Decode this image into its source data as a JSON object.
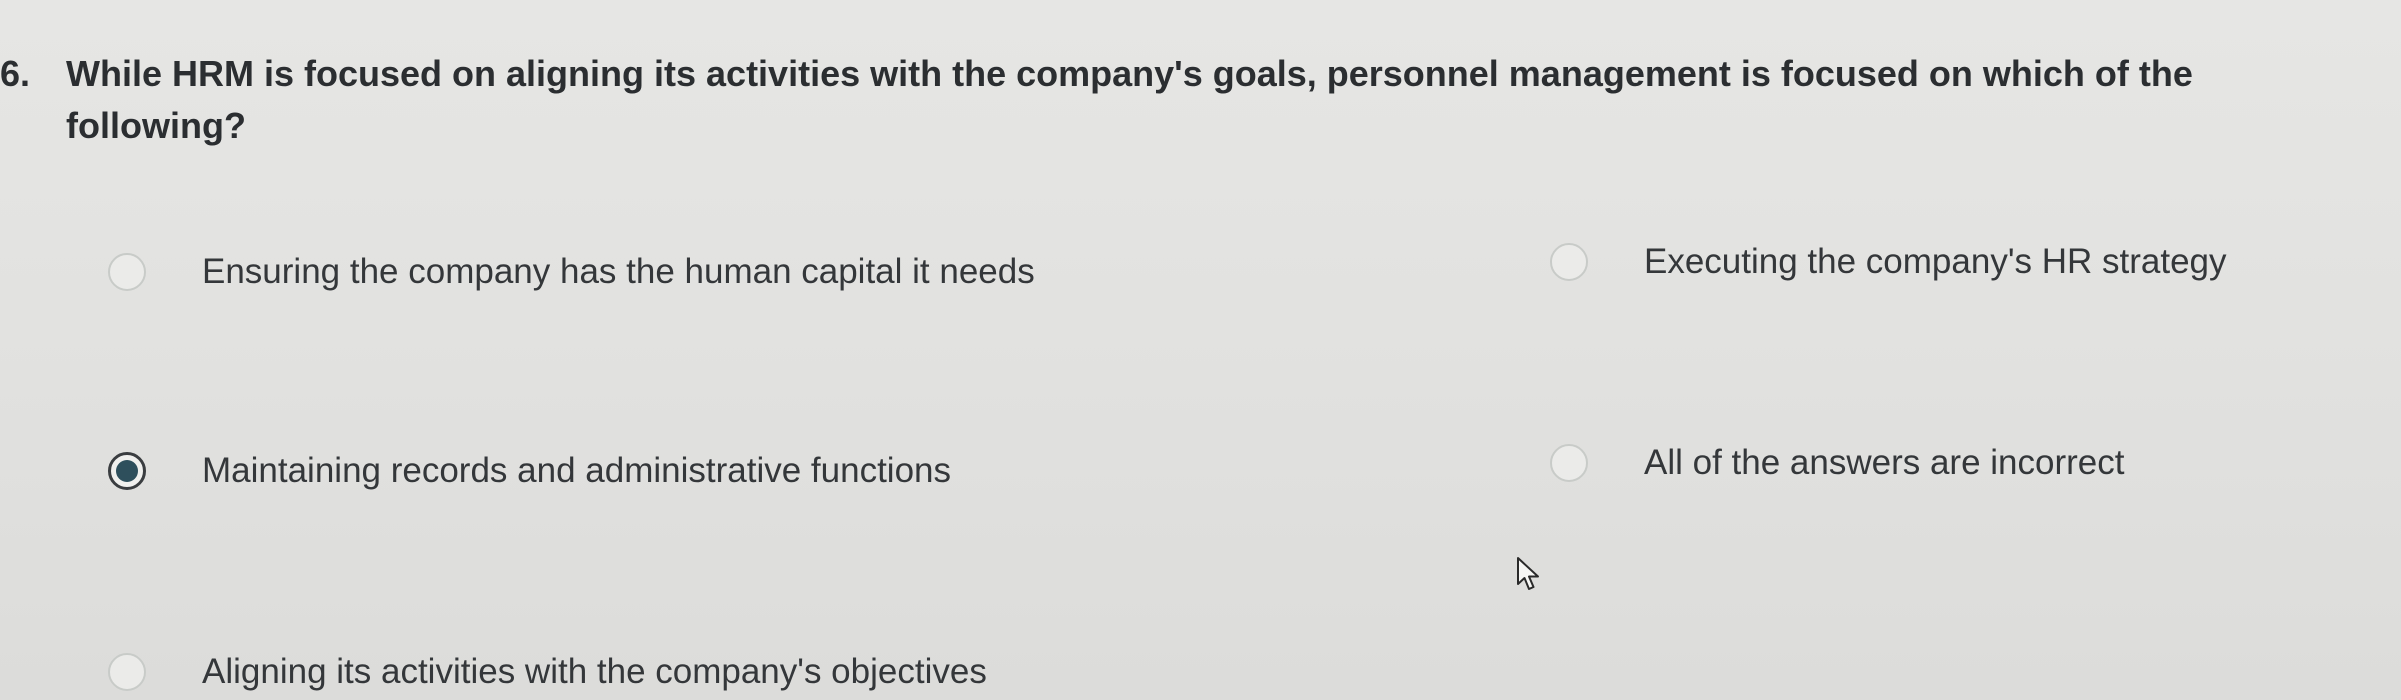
{
  "question": {
    "number": "6.",
    "text": "While HRM is focused on aligning its activities with the company's goals, personnel management is focused on which of the following?"
  },
  "options": [
    {
      "label": "Ensuring the company has the human capital it needs",
      "selected": false
    },
    {
      "label": "Executing the company's HR strategy",
      "selected": false
    },
    {
      "label": "Maintaining records and administrative functions",
      "selected": true
    },
    {
      "label": "All of the answers are incorrect",
      "selected": false
    },
    {
      "label": "Aligning its activities with the company's objectives",
      "selected": false
    }
  ],
  "colors": {
    "background": "#e2e2e0",
    "text": "#2f3236",
    "selected_dot": "#2e4f5c"
  },
  "icons": {
    "cursor": "mouse-pointer-icon"
  }
}
